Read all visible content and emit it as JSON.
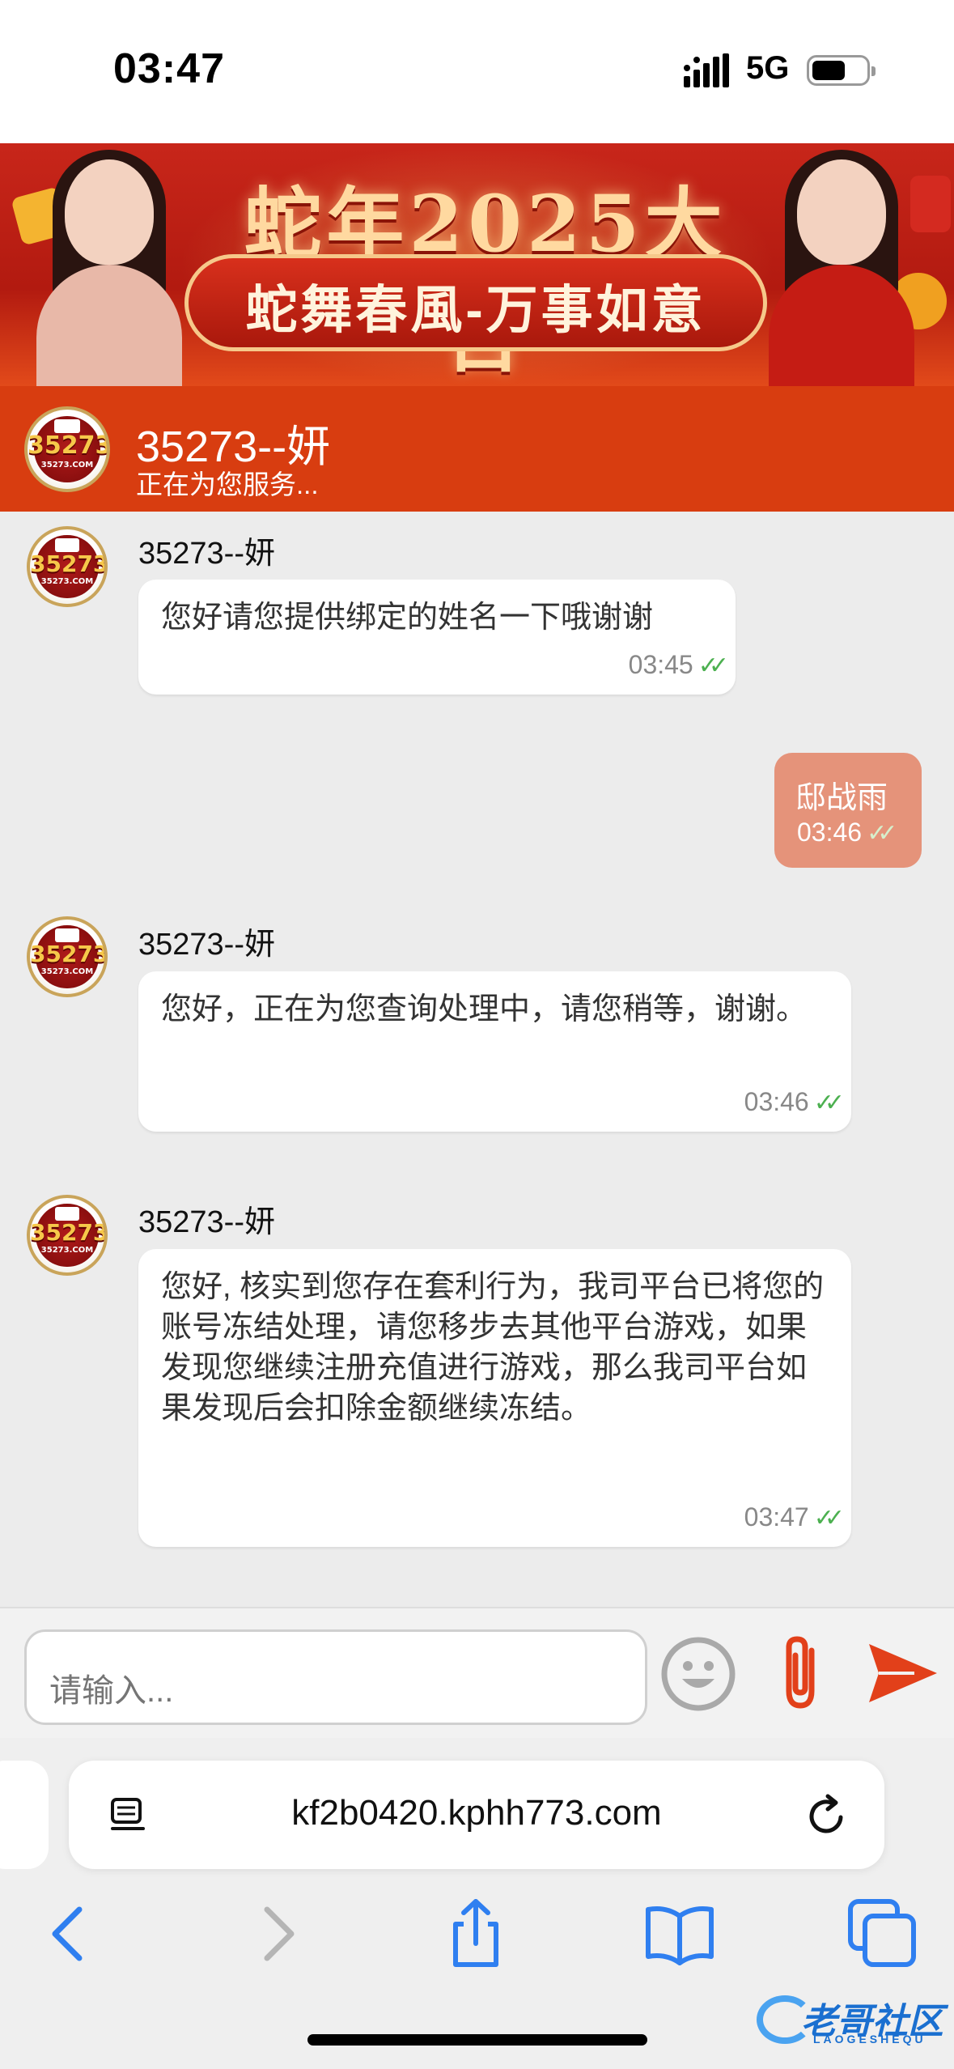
{
  "status_bar": {
    "time": "03:47",
    "network": "5G"
  },
  "banner": {
    "headline": "蛇年2025大吉",
    "slogan": "蛇舞春風-万事如意"
  },
  "header": {
    "name": "35273--妍",
    "status": "正在为您服务..."
  },
  "avatar": {
    "number": "35273",
    "domain": "35273.COM"
  },
  "messages": [
    {
      "direction": "incoming",
      "sender": "35273--妍",
      "text": "您好请您提供绑定的姓名一下哦谢谢",
      "time": "03:45"
    },
    {
      "direction": "outgoing",
      "text": "邸战雨",
      "time": "03:46"
    },
    {
      "direction": "incoming",
      "sender": "35273--妍",
      "text": "您好，正在为您查询处理中，请您稍等，谢谢。",
      "time": "03:46"
    },
    {
      "direction": "incoming",
      "sender": "35273--妍",
      "text": "您好, 核实到您存在套利行为，我司平台已将您的账号冻结处理，请您移步去其他平台游戏，如果发现您继续注册充值进行游戏，那么我司平台如果发现后会扣除金额继续冻结。",
      "time": "03:47"
    }
  ],
  "input": {
    "placeholder": "请输入..."
  },
  "browser": {
    "url": "kf2b0420.kphh773.com"
  },
  "watermark": {
    "main": "老哥社区",
    "sub": "LAOGESHEQU"
  },
  "colors": {
    "header_bg": "#d83d10",
    "outgoing_bubble": "#e5937a",
    "send_accent": "#e2401a",
    "ios_blue": "#2f7ff0",
    "read_check": "#4cb050"
  },
  "icons": {
    "emoji": "smiley-face-icon",
    "attach": "paperclip-icon",
    "send": "send-arrow-icon",
    "reload": "reload-icon",
    "page_menu": "page-menu-icon",
    "back": "chevron-left-icon",
    "forward": "chevron-right-icon",
    "share": "share-icon",
    "bookmarks": "book-icon",
    "tabs": "tabs-icon"
  }
}
